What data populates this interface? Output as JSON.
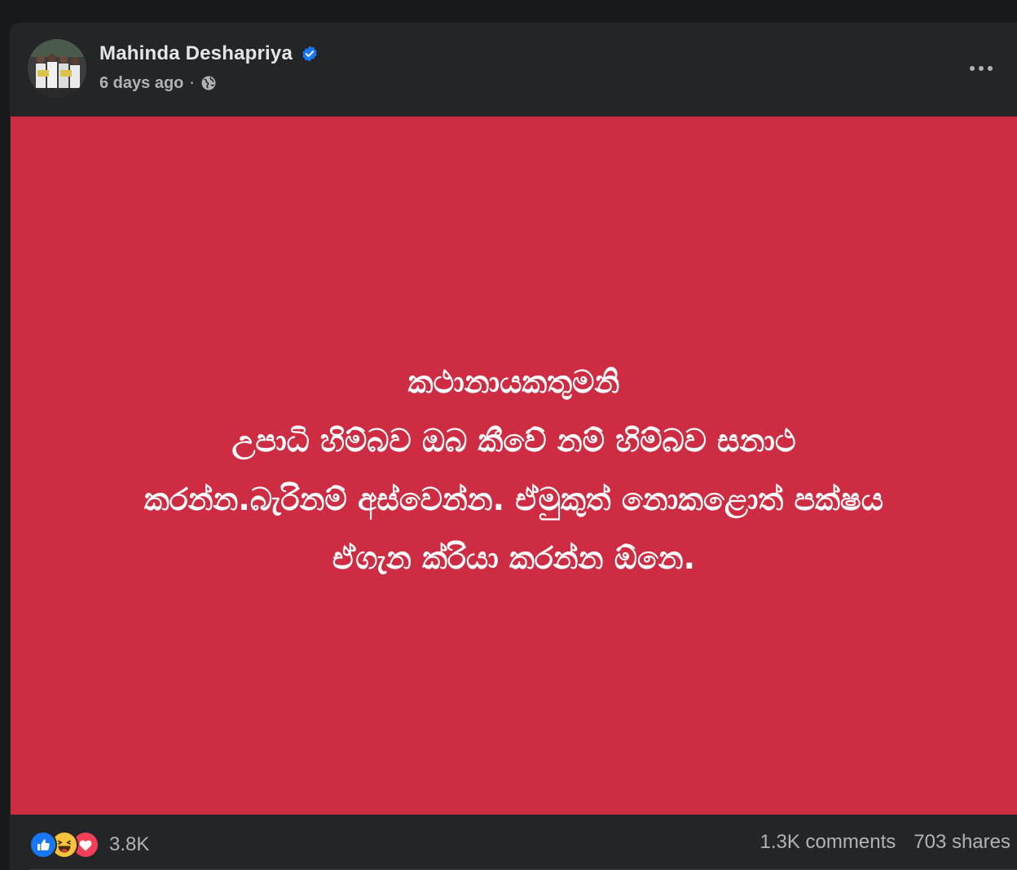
{
  "post": {
    "author": "Mahinda Deshapriya",
    "verified": true,
    "timestamp": "6 days ago",
    "separator": "·",
    "audience_icon": "globe-icon",
    "more_icon": "more-options-icon",
    "media": {
      "background_color": "#cd2c42",
      "lines": [
        "කථානායකතුමනි",
        "උපාධි හිම්බව ඔබ කීවේ නම් හිම්බව සනාථ",
        "කරන්න.බැරිනම් අස්වෙන්න. ඒමුකුත් නොකළොත් පක්ෂය",
        "ඒගැන ක්රියා කරන්න ඕනෙ."
      ]
    }
  },
  "engagement": {
    "reaction_icons": [
      "like-icon",
      "haha-icon",
      "love-icon"
    ],
    "reaction_count": "3.8K",
    "comments": "1.3K comments",
    "shares": "703 shares"
  },
  "colors": {
    "page_bg": "#18191a",
    "card_bg": "#242526",
    "accent_blue": "#1877f2",
    "text_primary": "#e4e6eb",
    "text_secondary": "#b0b3b8"
  }
}
